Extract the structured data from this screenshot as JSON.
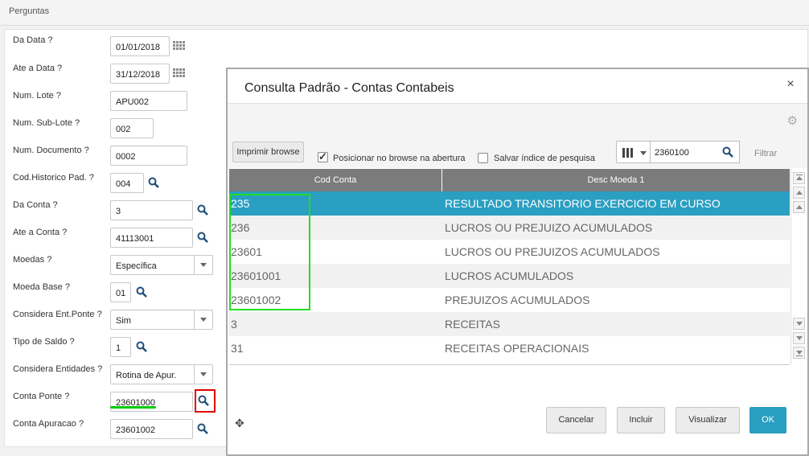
{
  "page": {
    "title": "Perguntas"
  },
  "questions": [
    {
      "label": "Da Data ?",
      "value": "01/01/2018"
    },
    {
      "label": "Ate a Data ?",
      "value": "31/12/2018"
    },
    {
      "label": "Num. Lote ?",
      "value": "APU002"
    },
    {
      "label": "Num. Sub-Lote ?",
      "value": "002"
    },
    {
      "label": "Num. Documento ?",
      "value": "0002"
    },
    {
      "label": "Cod.Historico Pad. ?",
      "value": "004"
    },
    {
      "label": "Da Conta ?",
      "value": "3"
    },
    {
      "label": "Ate a Conta ?",
      "value": "41113001"
    },
    {
      "label": "Moedas ?",
      "value": "Específica"
    },
    {
      "label": "Moeda Base ?",
      "value": "01"
    },
    {
      "label": "Considera Ent.Ponte ?",
      "value": "Sim"
    },
    {
      "label": "Tipo de Saldo ?",
      "value": "1"
    },
    {
      "label": "Considera Entidades ?",
      "value": "Rotina de Apur."
    },
    {
      "label": "Conta Ponte ?",
      "value": "23601000"
    },
    {
      "label": "Conta Apuracao ?",
      "value": "23601002"
    }
  ],
  "modal": {
    "title": "Consulta Padrão - Contas Contabeis",
    "close": "×",
    "print_button": "Imprimir browse",
    "option_position": "Posicionar no browse na abertura",
    "option_position_checked": true,
    "option_save_index": "Salvar índice de pesquisa",
    "option_save_index_checked": false,
    "search_value": "2360100",
    "filter_label": "Filtrar",
    "columns": [
      "Cod Conta",
      "Desc Moeda 1"
    ],
    "rows": [
      {
        "code": "235",
        "desc": "RESULTADO TRANSITORIO EXERCICIO EM CURSO",
        "selected": true
      },
      {
        "code": "236",
        "desc": "LUCROS OU PREJUIZO ACUMULADOS"
      },
      {
        "code": "23601",
        "desc": "LUCROS OU PREJUIZOS ACUMULADOS"
      },
      {
        "code": "23601001",
        "desc": "LUCROS ACUMULADOS"
      },
      {
        "code": "23601002",
        "desc": "PREJUIZOS ACUMULADOS"
      },
      {
        "code": "3",
        "desc": "RECEITAS"
      },
      {
        "code": "31",
        "desc": "RECEITAS OPERACIONAIS"
      }
    ],
    "buttons": {
      "cancel": "Cancelar",
      "include": "Incluir",
      "view": "Visualizar",
      "ok": "OK"
    }
  },
  "colors": {
    "accent": "#2a9fc1",
    "highlight_red": "#e00000",
    "highlight_green": "#22dd22"
  }
}
